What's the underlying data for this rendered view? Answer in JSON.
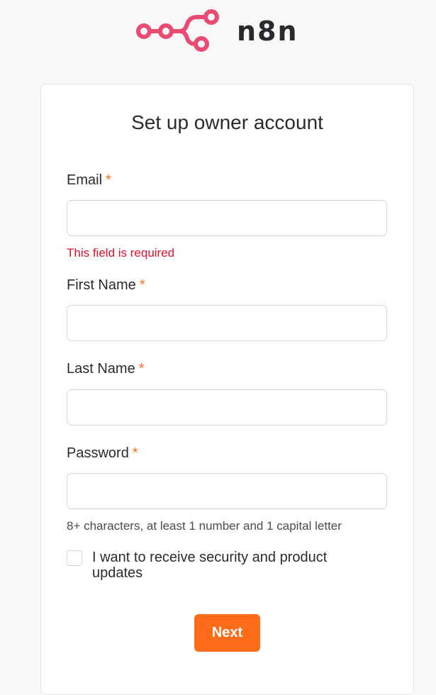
{
  "brand": {
    "name": "n8n",
    "logo_color": "#ea4b71"
  },
  "form": {
    "title": "Set up owner account",
    "required_marker": "*",
    "fields": [
      {
        "label": "Email",
        "value": "",
        "error": "This field is required"
      },
      {
        "label": "First Name",
        "value": ""
      },
      {
        "label": "Last Name",
        "value": ""
      },
      {
        "label": "Password",
        "value": "",
        "hint": "8+ characters, at least 1 number and 1 capital letter"
      }
    ],
    "checkbox": {
      "label": "I want to receive security and product updates",
      "checked": false
    },
    "submit_label": "Next"
  },
  "colors": {
    "accent": "#ff6d1a",
    "error": "#e0122d",
    "background": "#f8f8f9"
  }
}
